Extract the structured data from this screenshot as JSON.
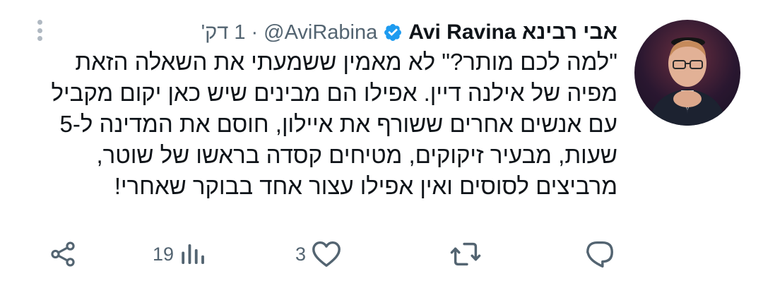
{
  "tweet": {
    "author_name": "Avi Ravina אבי רבינא",
    "handle": "@AviRabina",
    "separator": "·",
    "time": "1 דק'",
    "lines": [
      "\"למה לכם מותר?\" לא מאמין ששמעתי את השאלה הזאת",
      "מפיה של אילנה דיין. אפילו הם מבינים שיש כאן יקום מקביל",
      "עם אנשים אחרים ששורף את איילון, חוסם את המדינה ל-5",
      "שעות, מבעיר זיקוקים, מטיחים קסדה בראשו של שוטר,",
      "מרביצים לסוסים ואין אפילו עצור אחד בבוקר שאחרי!"
    ]
  },
  "actions": {
    "reply_count": "",
    "retweet_count": "",
    "like_count": "3",
    "views_count": "19"
  },
  "icons": {
    "verified": "verified-badge-icon",
    "more": "more-options-icon",
    "reply": "reply-icon",
    "retweet": "retweet-icon",
    "like": "heart-icon",
    "views": "views-bar-chart-icon",
    "share": "share-icon"
  },
  "colors": {
    "verified_blue": "#1d9bf0",
    "text": "#0f1419",
    "secondary": "#536471"
  }
}
